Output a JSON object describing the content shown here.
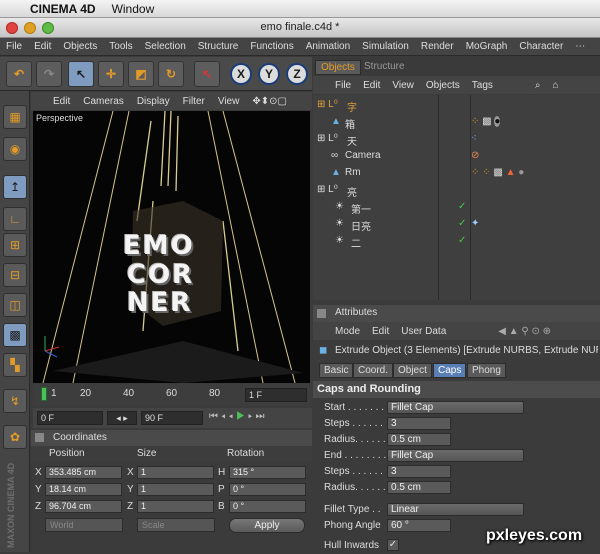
{
  "mac_menu": {
    "app": "CINEMA 4D",
    "window": "Window"
  },
  "window_title": "emo finale.c4d *",
  "main_menu": [
    "File",
    "Edit",
    "Objects",
    "Tools",
    "Selection",
    "Structure",
    "Functions",
    "Animation",
    "Simulation",
    "Render",
    "MoGraph",
    "Character"
  ],
  "toolbar": {
    "axis_x": "X",
    "axis_y": "Y",
    "axis_z": "Z"
  },
  "viewport": {
    "menu": [
      "Edit",
      "Cameras",
      "Display",
      "Filter",
      "View"
    ],
    "label": "Perspective",
    "scene_text": [
      "EMO",
      "CORNER"
    ]
  },
  "timeline": {
    "ticks": [
      "1",
      "20",
      "40",
      "60",
      "80"
    ],
    "frame_field": "1 F"
  },
  "transport": {
    "start": "0 F",
    "end": "90 F"
  },
  "coordinates": {
    "title": "Coordinates",
    "cols": [
      "Position",
      "Size",
      "Rotation"
    ],
    "rows": [
      {
        "pl": "X",
        "pv": "353.485 cm",
        "sl": "X",
        "sv": "1",
        "rl": "H",
        "rv": "315 °"
      },
      {
        "pl": "Y",
        "pv": "18.14 cm",
        "sl": "Y",
        "sv": "1",
        "rl": "P",
        "rv": "0 °"
      },
      {
        "pl": "Z",
        "pv": "96.704 cm",
        "sl": "Z",
        "sv": "1",
        "rl": "B",
        "rv": "0 °"
      }
    ],
    "world": "World",
    "scale": "Scale",
    "apply": "Apply"
  },
  "object_manager": {
    "tabs": [
      "Objects",
      "Structure"
    ],
    "menu": [
      "File",
      "Edit",
      "View",
      "Objects",
      "Tags"
    ],
    "objects": [
      {
        "name": "字",
        "icon": "null-icon",
        "color": "#e0a040"
      },
      {
        "name": "箱",
        "icon": "extrude-icon",
        "color": "#dddddd"
      },
      {
        "name": "天",
        "icon": "null-icon",
        "color": "#dddddd"
      },
      {
        "name": "Camera",
        "icon": "camera-icon",
        "color": "#dddddd"
      },
      {
        "name": "Rm",
        "icon": "extrude-icon",
        "color": "#dddddd"
      },
      {
        "name": "亮",
        "icon": "null-icon",
        "color": "#dddddd"
      },
      {
        "name": "第一",
        "icon": "light-icon",
        "color": "#dddddd"
      },
      {
        "name": "日亮",
        "icon": "light-icon",
        "color": "#dddddd"
      },
      {
        "name": "二",
        "icon": "light-icon",
        "color": "#dddddd"
      }
    ]
  },
  "attributes": {
    "title": "Attributes",
    "menu": [
      "Mode",
      "Edit",
      "User Data"
    ],
    "object_title": "Extrude Object (3 Elements) [Extrude NURBS, Extrude NURB",
    "tabs": [
      "Basic",
      "Coord.",
      "Object",
      "Caps",
      "Phong"
    ],
    "active_tab": "Caps",
    "section": "Caps and Rounding",
    "fields": [
      {
        "label": "Start . . . . . . .",
        "value": "Fillet Cap",
        "kind": "dropdown"
      },
      {
        "label": "Steps . . . . . .",
        "value": "3",
        "kind": "number"
      },
      {
        "label": "Radius. . . . . .",
        "value": "0.5 cm",
        "kind": "number"
      },
      {
        "label": "End . . . . . . . .",
        "value": "Fillet Cap",
        "kind": "dropdown"
      },
      {
        "label": "Steps . . . . . .",
        "value": "3",
        "kind": "number"
      },
      {
        "label": "Radius. . . . . .",
        "value": "0.5 cm",
        "kind": "number"
      },
      {
        "label": "Fillet Type . .",
        "value": "Linear",
        "kind": "dropdown"
      },
      {
        "label": "Phong Angle",
        "value": "60 °",
        "kind": "number"
      },
      {
        "label": "Hull Inwards",
        "value": "",
        "kind": "checkbox"
      }
    ]
  },
  "branding": {
    "maxon": "MAXON CINEMA 4D",
    "watermark": "pxleyes.com"
  }
}
